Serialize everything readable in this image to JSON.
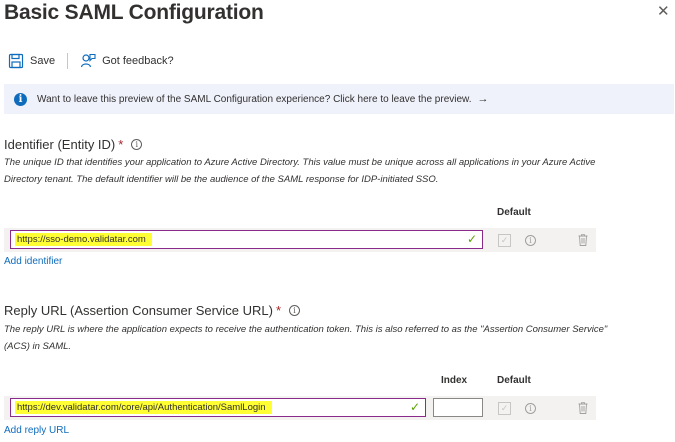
{
  "header": {
    "title": "Basic SAML Configuration",
    "close_icon": "close-icon"
  },
  "toolbar": {
    "save_label": "Save",
    "save_icon": "save-icon",
    "feedback_label": "Got feedback?",
    "feedback_icon": "feedback-icon"
  },
  "banner": {
    "text": "Want to leave this preview of the SAML Configuration experience? Click here to leave the preview.",
    "arrow": "→",
    "icon": "info-icon"
  },
  "identifier": {
    "label": "Identifier (Entity ID)",
    "required_mark": "*",
    "description": "The unique ID that identifies your application to Azure Active Directory. This value must be unique across all applications in your Azure Active Directory tenant. The default identifier will be the audience of the SAML response for IDP-initiated SSO.",
    "default_header": "Default",
    "value": "https://sso-demo.validatar.com",
    "add_link": "Add identifier"
  },
  "reply_url": {
    "label": "Reply URL (Assertion Consumer Service URL)",
    "required_mark": "*",
    "description": "The reply URL is where the application expects to receive the authentication token. This is also referred to as the \"Assertion Consumer Service\" (ACS) in SAML.",
    "index_header": "Index",
    "default_header": "Default",
    "value": "https://dev.validatar.com/core/api/Authentication/SamlLogin",
    "index_value": "",
    "add_link": "Add reply URL"
  },
  "colors": {
    "accent": "#0f6cbd",
    "highlight": "#ffff33",
    "input_border": "#8a2a8a",
    "valid_check": "#57a300",
    "banner_bg": "#eff1fb",
    "required": "#a4262c"
  }
}
